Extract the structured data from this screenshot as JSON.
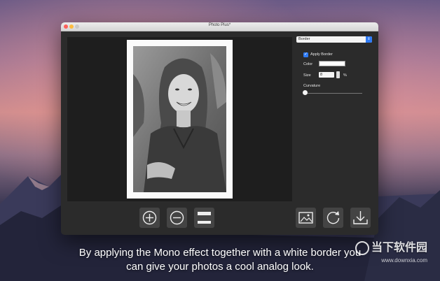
{
  "window": {
    "title": "Photo Plus*"
  },
  "panel": {
    "dropdown_value": "Border",
    "apply_border_label": "Apply Border",
    "apply_border_checked": true,
    "color_label": "Color",
    "border_color": "#ffffff",
    "size_label": "Size",
    "size_value": "8",
    "size_unit": "%",
    "curvature_label": "Curvature",
    "curvature_value": 0
  },
  "toolbar": {
    "zoom_in": "zoom-in-icon",
    "zoom_out": "zoom-out-icon",
    "fit": "fit-frame-icon",
    "image": "image-icon",
    "rotate": "rotate-icon",
    "save": "download-icon"
  },
  "caption": {
    "line1": "By applying the Mono effect together with a white border you",
    "line2": "can give your photos a cool analog look."
  },
  "watermark": {
    "text": "当下软件园",
    "url": "www.downxia.com"
  },
  "colors": {
    "accent": "#2f7bf5",
    "window_bg": "#2b2b2b",
    "canvas_bg": "#1e1e1e"
  }
}
